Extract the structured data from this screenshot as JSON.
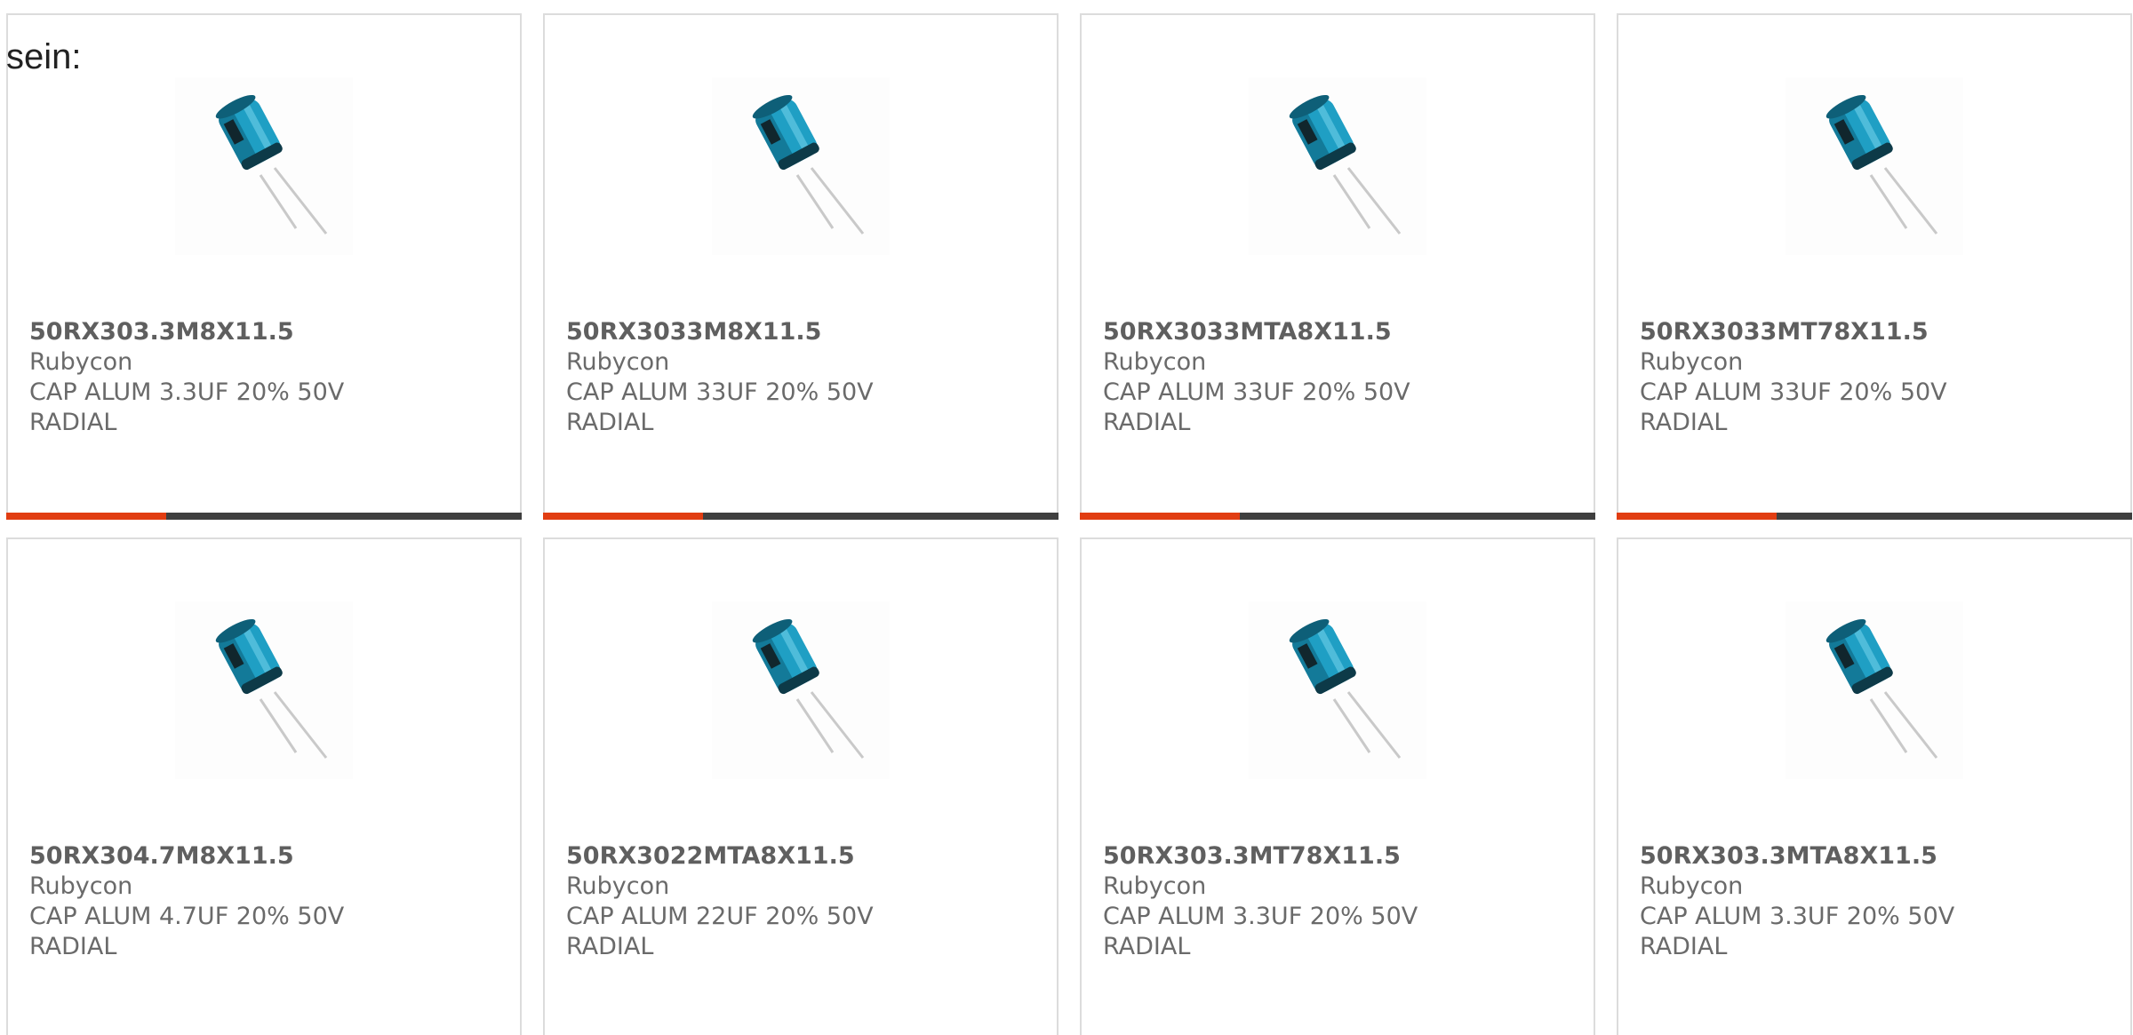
{
  "intro_text": "sein:",
  "colors": {
    "accent": "#e13d12",
    "bar_track": "#3f3f3f",
    "card_border": "#dcdcdc",
    "text": "#6a6a6a"
  },
  "products": [
    {
      "part": "50RX303.3M8X11.5",
      "brand": "Rubycon",
      "desc": "CAP ALUM 3.3UF 20% 50V",
      "package": "RADIAL",
      "image_icon": "capacitor-icon"
    },
    {
      "part": "50RX3033M8X11.5",
      "brand": "Rubycon",
      "desc": "CAP ALUM 33UF 20% 50V",
      "package": "RADIAL",
      "image_icon": "capacitor-icon"
    },
    {
      "part": "50RX3033MTA8X11.5",
      "brand": "Rubycon",
      "desc": "CAP ALUM 33UF 20% 50V",
      "package": "RADIAL",
      "image_icon": "capacitor-icon"
    },
    {
      "part": "50RX3033MT78X11.5",
      "brand": "Rubycon",
      "desc": "CAP ALUM 33UF 20% 50V",
      "package": "RADIAL",
      "image_icon": "capacitor-icon"
    },
    {
      "part": "50RX304.7M8X11.5",
      "brand": "Rubycon",
      "desc": "CAP ALUM 4.7UF 20% 50V",
      "package": "RADIAL",
      "image_icon": "capacitor-icon"
    },
    {
      "part": "50RX3022MTA8X11.5",
      "brand": "Rubycon",
      "desc": "CAP ALUM 22UF 20% 50V",
      "package": "RADIAL",
      "image_icon": "capacitor-icon"
    },
    {
      "part": "50RX303.3MT78X11.5",
      "brand": "Rubycon",
      "desc": "CAP ALUM 3.3UF 20% 50V",
      "package": "RADIAL",
      "image_icon": "capacitor-icon"
    },
    {
      "part": "50RX303.3MTA8X11.5",
      "brand": "Rubycon",
      "desc": "CAP ALUM 3.3UF 20% 50V",
      "package": "RADIAL",
      "image_icon": "capacitor-icon"
    }
  ],
  "progress_fraction": 0.31
}
